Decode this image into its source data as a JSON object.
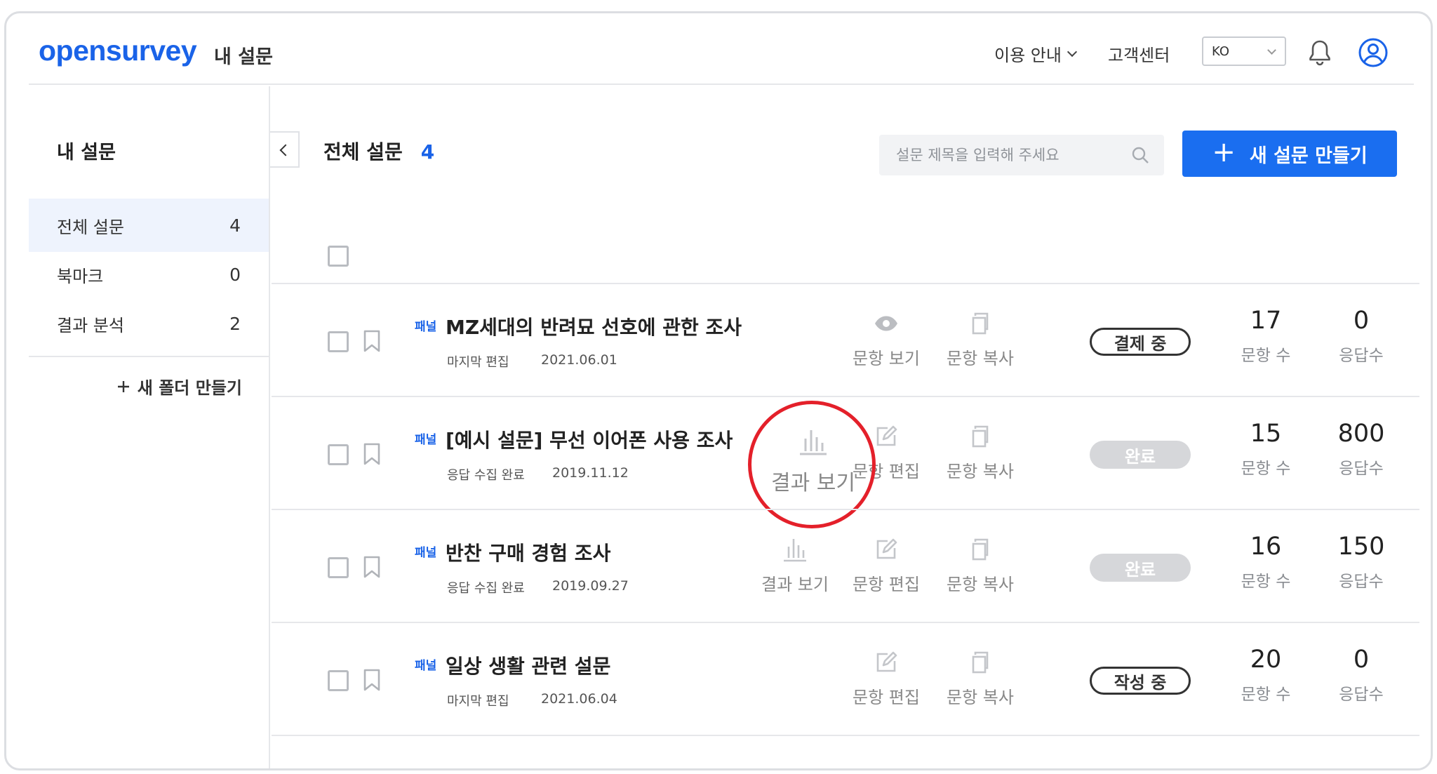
{
  "header": {
    "logo": "opensurvey",
    "title": "내 설문",
    "nav_guide": "이용 안내",
    "nav_support": "고객센터",
    "lang": "KO"
  },
  "sidebar": {
    "title": "내 설문",
    "items": [
      {
        "label": "전체 설문",
        "count": "4"
      },
      {
        "label": "북마크",
        "count": "0"
      },
      {
        "label": "결과 분석",
        "count": "2"
      }
    ],
    "new_folder": "새 폴더 만들기"
  },
  "main": {
    "title": "전체 설문",
    "count": "4",
    "search_placeholder": "설문 제목을 입력해 주세요",
    "new_survey": "새 설문 만들기"
  },
  "labels": {
    "view_questions": "문항 보기",
    "edit_questions": "문항 편집",
    "copy_questions": "문항 복사",
    "view_results": "결과 보기",
    "question_count": "문항 수",
    "response_count": "응답수",
    "panel": "패널"
  },
  "rows": [
    {
      "title": "MZ세대의 반려묘 선호에 관한 조사",
      "meta": "마지막 편집",
      "date": "2021.06.01",
      "status": "결제 중",
      "questions": "17",
      "responses": "0"
    },
    {
      "title": "[예시 설문] 무선 이어폰 사용 조사",
      "meta": "응답 수집 완료",
      "date": "2019.11.12",
      "status": "완료",
      "questions": "15",
      "responses": "800"
    },
    {
      "title": "반찬 구매 경험 조사",
      "meta": "응답 수집 완료",
      "date": "2019.09.27",
      "status": "완료",
      "questions": "16",
      "responses": "150"
    },
    {
      "title": "일상 생활 관련 설문",
      "meta": "마지막 편집",
      "date": "2021.06.04",
      "status": "작성 중",
      "questions": "20",
      "responses": "0"
    }
  ],
  "colors": {
    "brand": "#1a63e8",
    "button": "#1a6ef0",
    "highlight": "#e4202a",
    "done_badge": "#d6d7da"
  }
}
